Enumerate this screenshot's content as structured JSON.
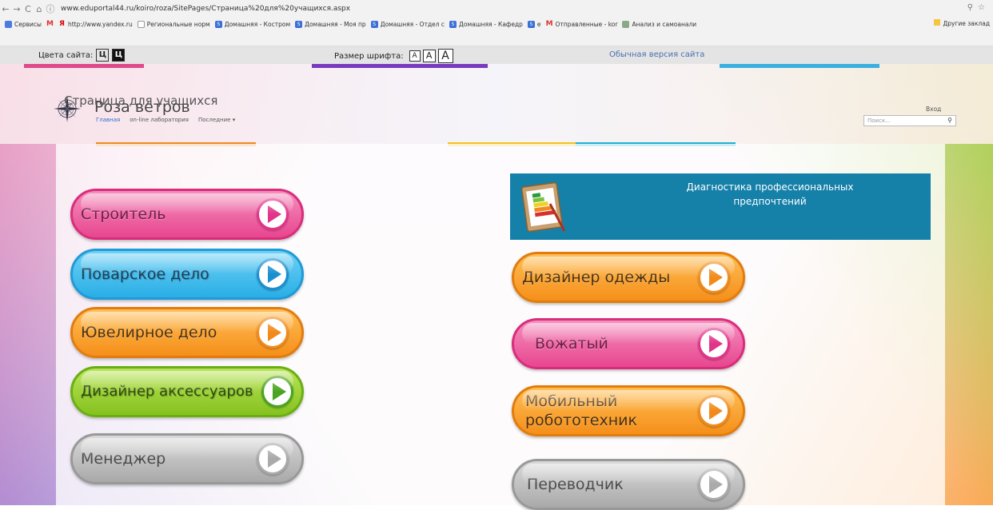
{
  "browser": {
    "url": "www.eduportal44.ru/koiro/roza/SitePages/Страница%20для%20учащихся.aspx",
    "bookmarks": [
      {
        "label": "Сервисы",
        "icon": "apps-icon"
      },
      {
        "label": "",
        "icon": "gmail-icon"
      },
      {
        "label": "http://www.yandex.ru",
        "icon": "yandex-icon"
      },
      {
        "label": "Региональные норм",
        "icon": "doc-icon"
      },
      {
        "label": "Домашняя - Костром",
        "icon": "sharepoint-icon"
      },
      {
        "label": "Домашняя - Моя пр",
        "icon": "sharepoint-icon"
      },
      {
        "label": "Домашняя - Отдел с",
        "icon": "sharepoint-icon"
      },
      {
        "label": "Домашняя - Кафедр",
        "icon": "sharepoint-icon"
      },
      {
        "label": "е",
        "icon": "sharepoint-icon"
      },
      {
        "label": "Отправленные - kor",
        "icon": "gmail-icon"
      },
      {
        "label": "Анализ и самоанали",
        "icon": "folder-icon"
      }
    ],
    "other_bookmarks": "Другие заклад"
  },
  "accessibility": {
    "colors_label": "Цвета сайта:",
    "color_light": "Ц",
    "color_dark": "Ц",
    "font_label": "Размер шрифта:",
    "font_small": "A",
    "font_medium": "A",
    "font_large": "A",
    "normal_version": "Обычная версия сайта"
  },
  "site": {
    "title": "Роза ветров",
    "nav": [
      "Главная",
      "on-line лаборатория",
      "Последние"
    ],
    "login": "Вход",
    "search_placeholder": "Поиск..."
  },
  "main": {
    "page_title": "Страница для учащихся",
    "diagnostics": "Диагностика профессиональных предпочтений",
    "left_buttons": [
      {
        "label": "Строитель",
        "color": "pink"
      },
      {
        "label": "Поварское дело",
        "color": "blue"
      },
      {
        "label": "Ювелирное дело",
        "color": "orange"
      },
      {
        "label": "Дизайнер аксессуаров",
        "color": "green"
      },
      {
        "label": "Менеджер",
        "color": "gray"
      }
    ],
    "right_buttons": [
      {
        "label": "Дизайнер одежды",
        "color": "orange"
      },
      {
        "label": "Вожатый",
        "color": "pink"
      },
      {
        "label": "Мобильный робототехник",
        "color": "orange"
      },
      {
        "label": "Переводчик",
        "color": "gray"
      }
    ]
  }
}
